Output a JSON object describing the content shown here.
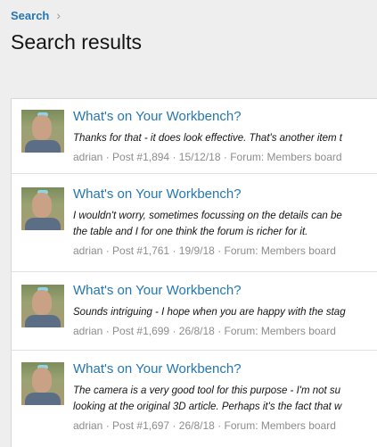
{
  "breadcrumb": {
    "home": "Search",
    "separator": "›"
  },
  "page": {
    "title": "Search results"
  },
  "results": [
    {
      "title": "What's on Your Workbench?",
      "snippet": [
        "Thanks for that - it does look effective. That's another item t"
      ],
      "author": "adrian",
      "post": "Post #1,894",
      "date": "15/12/18",
      "forum": "Forum: Members board"
    },
    {
      "title": "What's on Your Workbench?",
      "snippet": [
        "I wouldn't worry, sometimes focussing on the details can be",
        "the table and I for one think the forum is richer for it."
      ],
      "author": "adrian",
      "post": "Post #1,761",
      "date": "19/9/18",
      "forum": "Forum: Members board"
    },
    {
      "title": "What's on Your Workbench?",
      "snippet": [
        "Sounds intriguing - I hope when you are happy with the stag"
      ],
      "author": "adrian",
      "post": "Post #1,699",
      "date": "26/8/18",
      "forum": "Forum: Members board"
    },
    {
      "title": "What's on Your Workbench?",
      "snippet": [
        "The camera is a very good tool for this purpose - I'm not su",
        "looking at the original 3D article. Perhaps it's the fact that w"
      ],
      "author": "adrian",
      "post": "Post #1,697",
      "date": "26/8/18",
      "forum": "Forum: Members board"
    }
  ],
  "meta_separator": "·",
  "colors": {
    "link": "#2577b1",
    "muted": "#8c8c8c",
    "background": "#eeeeee"
  }
}
